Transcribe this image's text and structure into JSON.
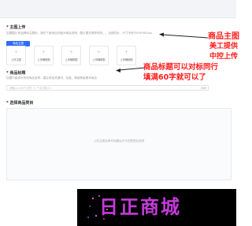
{
  "main_image": {
    "section_title": "* 主图上传",
    "description": "如果图片有品牌商主图标，请在下面添加可做对商品说明、图片要去掉修改的。。全部同步，尺寸不低于600*600px",
    "tab_label": "商品主图",
    "slots": [
      {
        "plus": "+",
        "label": "上传主图"
      },
      {
        "plus": "+",
        "label": "上传辅助图"
      },
      {
        "plus": "+",
        "label": "上传辅助图"
      },
      {
        "plus": "+",
        "label": "上传辅助图"
      },
      {
        "plus": "+",
        "label": "上传辅助图"
      }
    ]
  },
  "annotation_1": {
    "line1": "商品主图",
    "line2": "美工提供",
    "line3": "中控上传"
  },
  "product_title": {
    "section_title": "* 商品标题",
    "description": "标题只能填写有效商品名称，建议添加关键词。功能、等级等级基本商品",
    "placeholder": "请输入1-60个字符（1 个文字算 2）",
    "counter": "0/60"
  },
  "annotation_2": {
    "line1": "商品标题可以对标同行",
    "line2": "填满60字就可以了"
  },
  "category": {
    "section_title": "* 选择商品类目",
    "hint": "上传主图及填写标题后才可匹配类目选项"
  },
  "logo": {
    "text": "日正商城"
  }
}
